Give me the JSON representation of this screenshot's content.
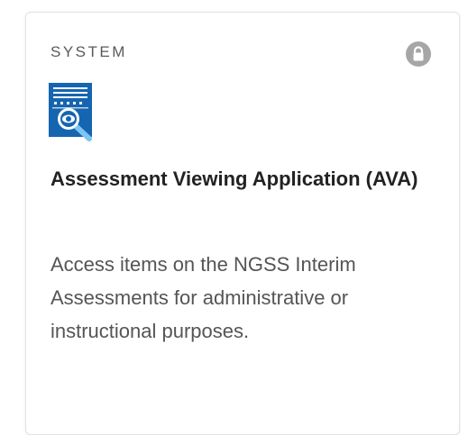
{
  "card": {
    "category": "SYSTEM",
    "lock_icon": "lock-icon",
    "app_icon": "assessment-viewer-icon",
    "title": "Assessment Viewing Application (AVA)",
    "description": "Access items on the NGSS Interim Assessments for administrative or instructional purposes."
  },
  "colors": {
    "icon_blue": "#1565b0",
    "icon_light_blue": "#7cc4f2",
    "lock_gray": "#a6a6a6",
    "title_text": "#222222",
    "description_text": "#555555"
  }
}
